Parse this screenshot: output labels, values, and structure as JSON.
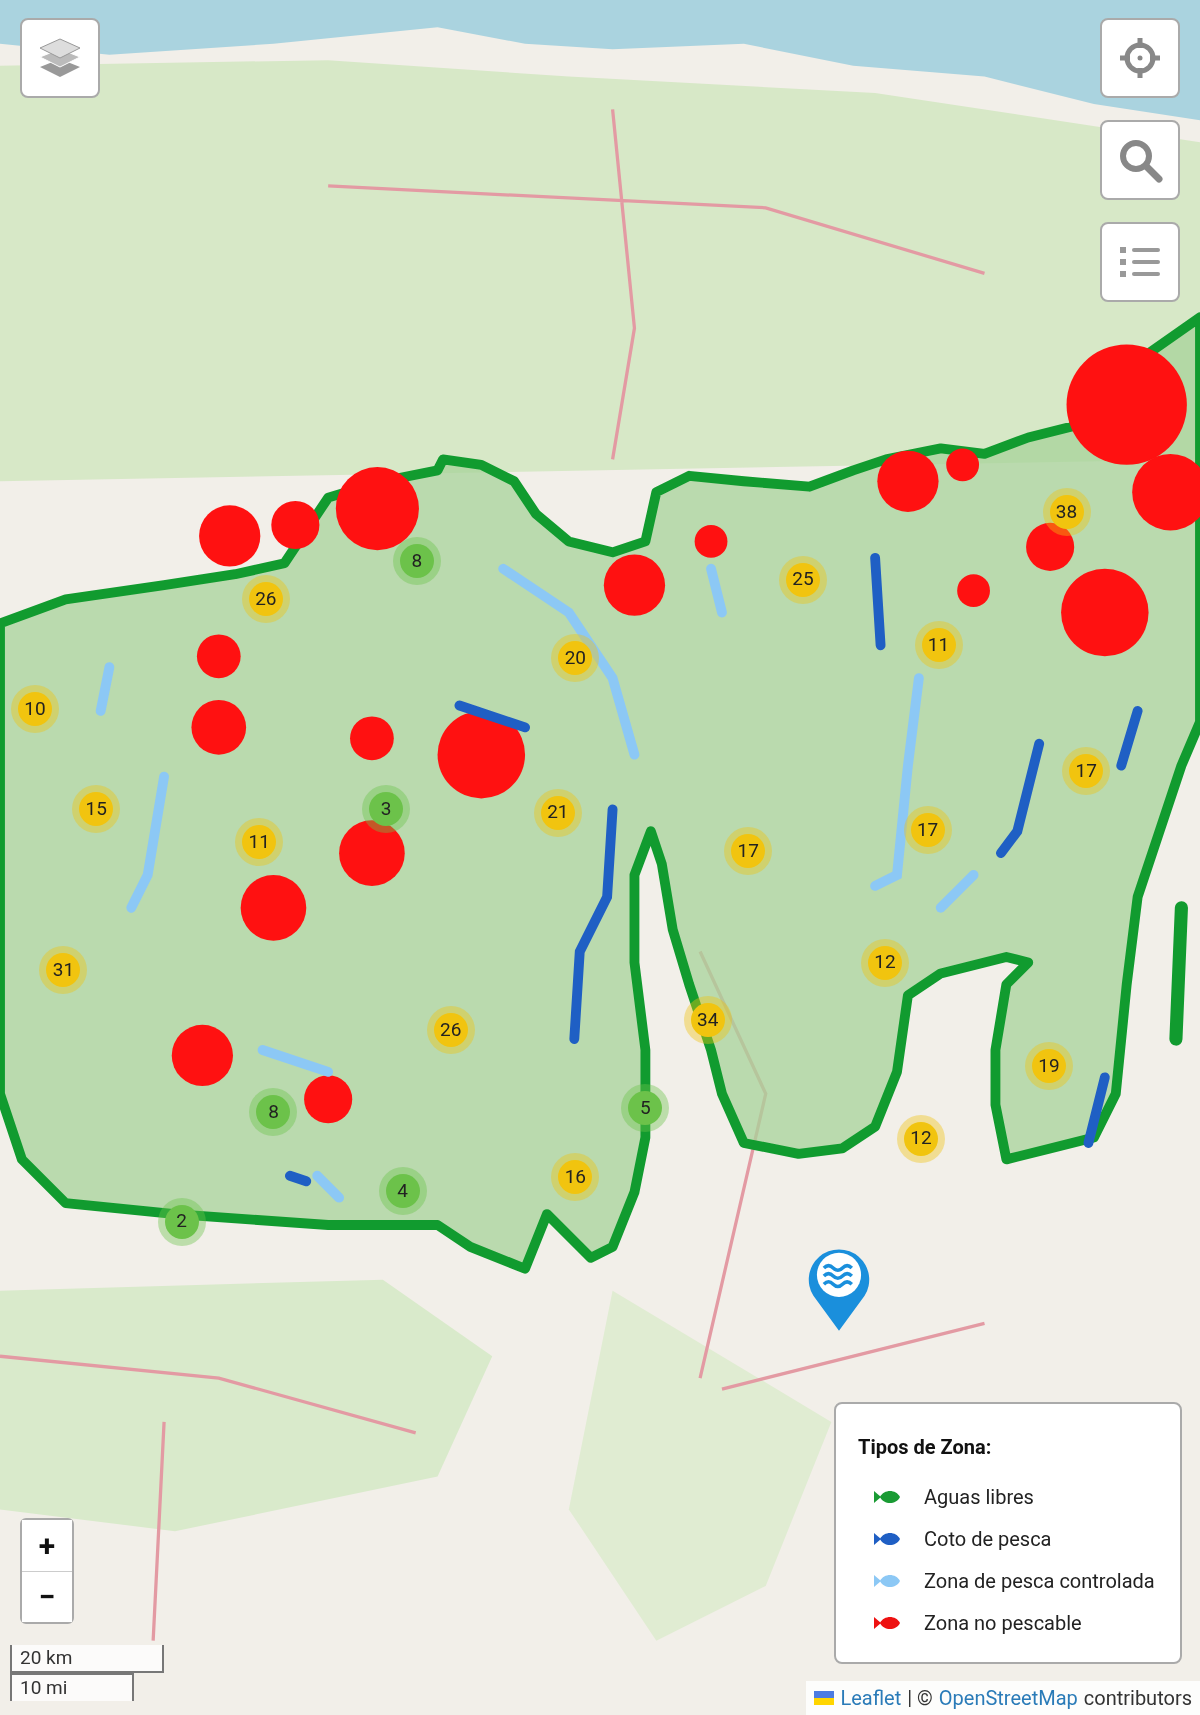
{
  "map_controls": {
    "zoom_in": "+",
    "zoom_out": "−"
  },
  "clusters": [
    {
      "count": "26",
      "color": "#f1c40f"
    },
    {
      "count": "8",
      "color": "#6cc24a"
    },
    {
      "count": "10",
      "color": "#f1c40f"
    },
    {
      "count": "20",
      "color": "#f1c40f"
    },
    {
      "count": "25",
      "color": "#f1c40f"
    },
    {
      "count": "38",
      "color": "#f1c40f"
    },
    {
      "count": "11",
      "color": "#f1c40f"
    },
    {
      "count": "15",
      "color": "#f1c40f"
    },
    {
      "count": "3",
      "color": "#6cc24a"
    },
    {
      "count": "11",
      "color": "#f1c40f"
    },
    {
      "count": "21",
      "color": "#f1c40f"
    },
    {
      "count": "17",
      "color": "#f1c40f"
    },
    {
      "count": "17",
      "color": "#f1c40f"
    },
    {
      "count": "17",
      "color": "#f1c40f"
    },
    {
      "count": "31",
      "color": "#f1c40f"
    },
    {
      "count": "12",
      "color": "#f1c40f"
    },
    {
      "count": "26",
      "color": "#f1c40f"
    },
    {
      "count": "34",
      "color": "#f1c40f"
    },
    {
      "count": "19",
      "color": "#f1c40f"
    },
    {
      "count": "8",
      "color": "#6cc24a"
    },
    {
      "count": "5",
      "color": "#6cc24a"
    },
    {
      "count": "12",
      "color": "#f1c40f"
    },
    {
      "count": "16",
      "color": "#f1c40f"
    },
    {
      "count": "4",
      "color": "#6cc24a"
    },
    {
      "count": "2",
      "color": "#6cc24a"
    }
  ],
  "legend": {
    "title": "Tipos de Zona:",
    "items": [
      {
        "label": "Aguas libres",
        "color": "#1a9b34"
      },
      {
        "label": "Coto de pesca",
        "color": "#1f5fc4"
      },
      {
        "label": "Zona de pesca controlada",
        "color": "#8cc8f5"
      },
      {
        "label": "Zona no pescable",
        "color": "#ee1111"
      }
    ]
  },
  "scale": {
    "metric": "20 km",
    "imperial": "10 mi"
  },
  "attribution": {
    "library": "Leaflet",
    "separator": "| ©",
    "source": "OpenStreetMap",
    "suffix": "contributors"
  }
}
